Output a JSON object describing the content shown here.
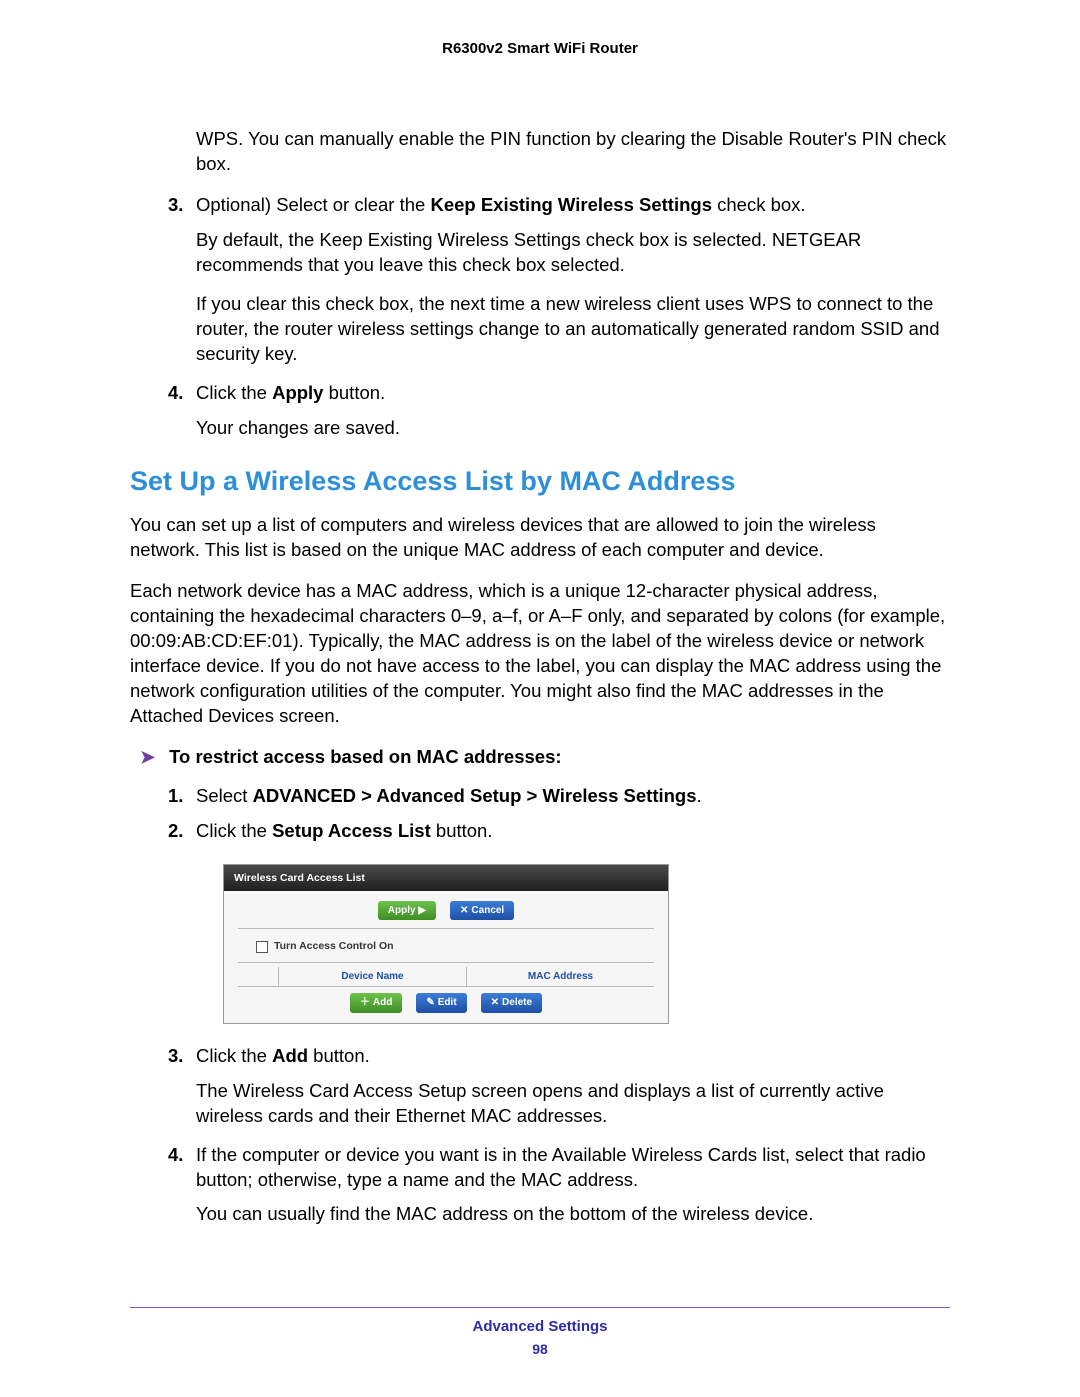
{
  "header": {
    "product": "R6300v2 Smart WiFi Router"
  },
  "top_continuation": "WPS. You can manually enable the PIN function by clearing the Disable Router's PIN check box.",
  "step3": {
    "num": "3.",
    "lead": "Optional) Select or clear the ",
    "bold": "Keep Existing Wireless Settings",
    "tail": " check box.",
    "p1": "By default, the Keep Existing Wireless Settings check box is selected. NETGEAR recommends that you leave this check box selected.",
    "p2": "If you clear this check box, the next time a new wireless client uses WPS to connect to the router, the router wireless settings change to an automatically generated random SSID and security key."
  },
  "step4": {
    "num": "4.",
    "lead": "Click the ",
    "bold": "Apply",
    "tail": " button.",
    "p1": "Your changes are saved."
  },
  "section_title": "Set Up a Wireless Access List by MAC Address",
  "section_p1": "You can set up a list of computers and wireless devices that are allowed to join the wireless network. This list is based on the unique MAC address of each computer and device.",
  "section_p2": "Each network device has a MAC address, which is a unique 12-character physical address, containing the hexadecimal characters 0–9, a–f, or A–F only, and separated by colons (for example, 00:09:AB:CD:EF:01). Typically, the MAC address is on the label of the wireless device or network interface device. If you do not have access to the label, you can display the MAC address using the network configuration utilities of the computer. You might also find the MAC addresses in the Attached Devices screen.",
  "task_title": "To restrict access based on MAC addresses:",
  "tstep1": {
    "num": "1.",
    "lead": "Select ",
    "bold": "ADVANCED > Advanced Setup > Wireless Settings",
    "tail": "."
  },
  "tstep2": {
    "num": "2.",
    "lead": "Click the ",
    "bold": "Setup Access List",
    "tail": " button."
  },
  "ui": {
    "title": "Wireless Card Access List",
    "apply": "Apply ▶",
    "cancel": "Cancel",
    "cancel_x": "✕",
    "checkbox_label": "Turn Access Control On",
    "col_device": "Device Name",
    "col_mac": "MAC Address",
    "add": "Add",
    "add_icon": "＋",
    "edit": "Edit",
    "edit_icon": "✎",
    "delete": "Delete",
    "delete_icon": "✕"
  },
  "tstep3": {
    "num": "3.",
    "lead": "Click the ",
    "bold": "Add",
    "tail": " button.",
    "p1": "The Wireless Card Access Setup screen opens and displays a list of currently active wireless cards and their Ethernet MAC addresses."
  },
  "tstep4": {
    "num": "4.",
    "text": "If the computer or device you want is in the Available Wireless Cards list, select that radio button; otherwise, type a name and the MAC address.",
    "p1": "You can usually find the MAC address on the bottom of the wireless device."
  },
  "footer": {
    "section": "Advanced Settings",
    "page": "98"
  }
}
